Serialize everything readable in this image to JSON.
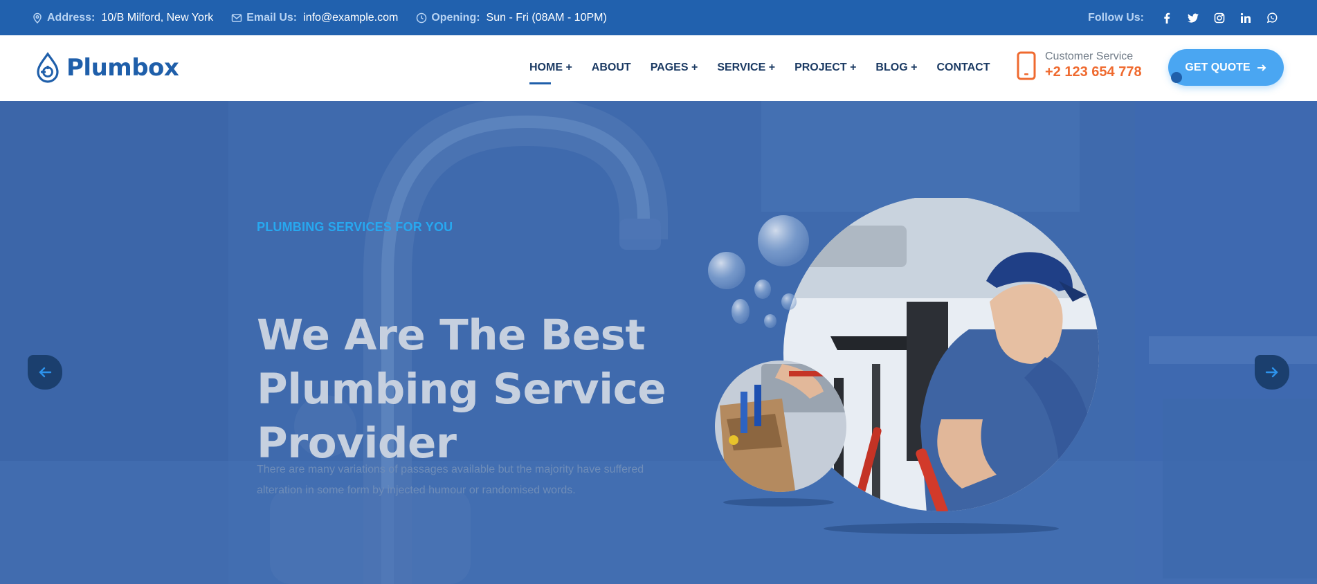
{
  "topbar": {
    "address_label": "Address:",
    "address_value": "10/B Milford, New York",
    "email_label": "Email Us:",
    "email_value": "info@example.com",
    "opening_label": "Opening:",
    "opening_value": "Sun - Fri (08AM - 10PM)",
    "follow_label": "Follow Us:",
    "socials": [
      "facebook-icon",
      "twitter-icon",
      "instagram-icon",
      "linkedin-icon",
      "whatsapp-icon"
    ]
  },
  "header": {
    "logo_text": "Plumbox",
    "nav": [
      "HOME +",
      "ABOUT",
      "PAGES +",
      "SERVICE +",
      "PROJECT +",
      "BLOG +",
      "CONTACT"
    ],
    "active_nav": "HOME +",
    "customer_service_label": "Customer Service",
    "customer_service_phone": "+2 123 654 778",
    "quote_button": "GET QUOTE"
  },
  "hero": {
    "subtitle": "PLUMBING SERVICES FOR YOU",
    "title": "We Are The Best Plumbing Service Provider",
    "description": "There are many variations of passages available but the majority have suffered alteration in some form by injected humour or randomised words."
  },
  "colors": {
    "topbar_bg": "#2161ae",
    "brand_blue": "#1f5faa",
    "accent_orange": "#ef6a2f",
    "accent_light_blue": "#4aa6f2",
    "hero_overlay": "#3c68ac"
  }
}
